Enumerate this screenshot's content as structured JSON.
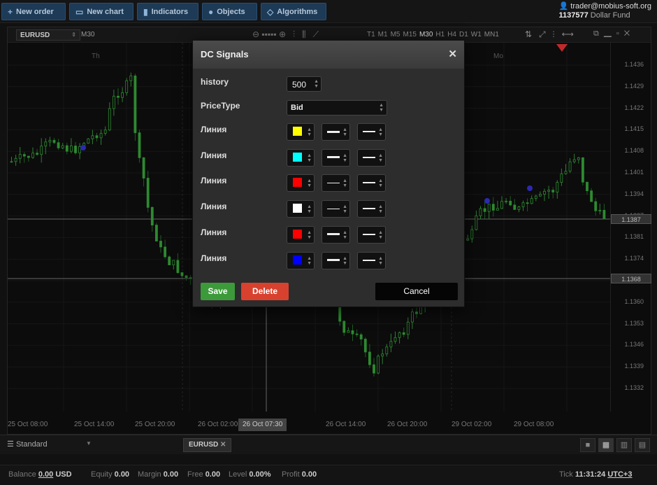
{
  "toolbar": {
    "new_order": "New order",
    "new_chart": "New chart",
    "indicators": "Indicators",
    "objects": "Objects",
    "algorithms": "Algorithms"
  },
  "user": {
    "email": "trader@mobius-soft.org",
    "account": "1137577",
    "fund": "Dollar Fund"
  },
  "chart": {
    "symbol": "EURUSD",
    "timeframe": "M30",
    "timeframes": [
      "T1",
      "M1",
      "M5",
      "M15",
      "M30",
      "H1",
      "H4",
      "D1",
      "W1",
      "MN1"
    ],
    "active_timeframe": "M30",
    "day_labels": [
      "Th",
      "Mo"
    ],
    "prices": [
      "1.1436",
      "1.1429",
      "1.1422",
      "1.1415",
      "1.1408",
      "1.1401",
      "1.1394",
      "1.1387",
      "1.1381",
      "1.1374",
      "1.1368",
      "1.1360",
      "1.1353",
      "1.1346",
      "1.1339",
      "1.1332"
    ],
    "price_tags": [
      "1.1387",
      "1.1368"
    ],
    "times": [
      "25 Oct 08:00",
      "25 Oct 14:00",
      "25 Oct 20:00",
      "26 Oct 02:00",
      "26 Oct 14:00",
      "26 Oct 20:00",
      "29 Oct 02:00",
      "29 Oct 08:00"
    ],
    "cursor_time": "26 Oct 07:30"
  },
  "modal": {
    "title": "DC Signals",
    "history_label": "history",
    "history_value": "500",
    "price_type_label": "PriceType",
    "price_type_value": "Bid",
    "lines": [
      {
        "label": "Линия",
        "color": "#ffff00"
      },
      {
        "label": "Линия",
        "color": "#00ffff"
      },
      {
        "label": "Линия",
        "color": "#ff0000"
      },
      {
        "label": "Линия",
        "color": "#ffffff"
      },
      {
        "label": "Линия",
        "color": "#ff0000"
      },
      {
        "label": "Линия",
        "color": "#0000ff"
      }
    ],
    "save": "Save",
    "delete": "Delete",
    "cancel": "Cancel"
  },
  "bottom": {
    "layout": "Standard",
    "tab": "EURUSD"
  },
  "status": {
    "balance_label": "Balance",
    "balance": "0.00",
    "currency": "USD",
    "equity_label": "Equity",
    "equity": "0.00",
    "margin_label": "Margin",
    "margin": "0.00",
    "free_label": "Free",
    "free": "0.00",
    "level_label": "Level",
    "level": "0.00%",
    "profit_label": "Profit",
    "profit": "0.00",
    "tick_label": "Tick",
    "time": "11:31:24",
    "tz": "UTC+3"
  }
}
